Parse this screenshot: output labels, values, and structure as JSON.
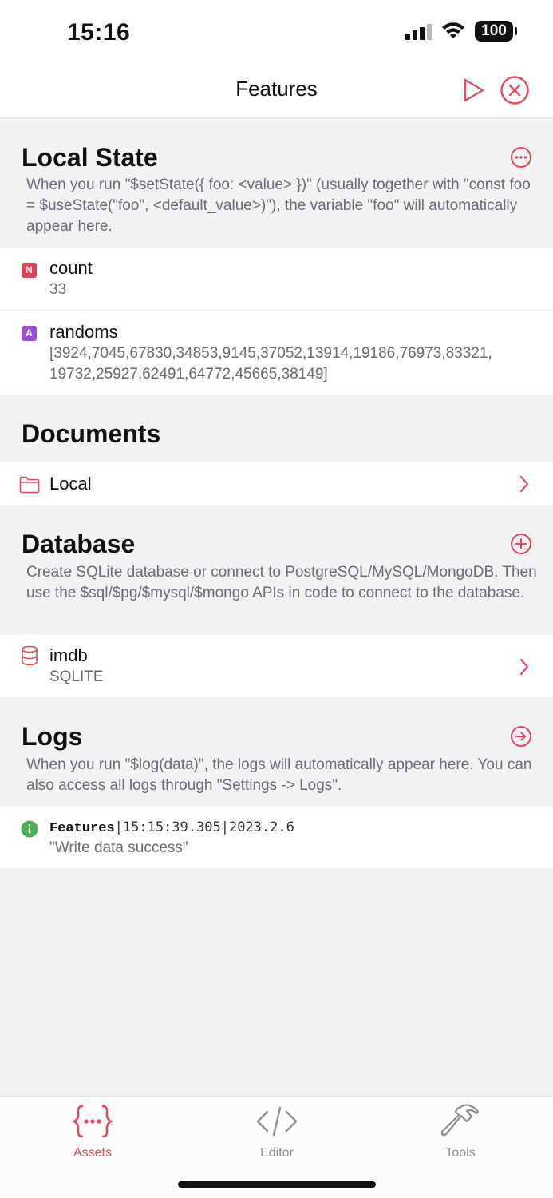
{
  "status_bar": {
    "time": "15:16",
    "battery": "100"
  },
  "nav": {
    "title": "Features",
    "run_icon": "play-icon",
    "close_icon": "close-circle-icon"
  },
  "local_state": {
    "title": "Local State",
    "description": "When you run \"$setState({ foo: <value> })\" (usually together with \"const foo = $useState(\"foo\", <default_value>)\"), the variable \"foo\" will automatically appear here.",
    "items": [
      {
        "badge": "N",
        "badge_color": "#e5405a",
        "name": "count",
        "value": "33"
      },
      {
        "badge": "A",
        "badge_color": "#9a4fd6",
        "name": "randoms",
        "value": "[3924,7045,67830,34853,9145,37052,13914,19186,76973,83321,\n19732,25927,62491,64772,45665,38149]"
      }
    ]
  },
  "documents": {
    "title": "Documents",
    "items": [
      {
        "icon": "folder-icon",
        "label": "Local"
      }
    ]
  },
  "database": {
    "title": "Database",
    "description": "Create SQLite database or connect to PostgreSQL/MySQL/MongoDB. Then use the $sql/$pg/$mysql/$mongo APIs in code to connect to the database.",
    "items": [
      {
        "icon": "database-icon",
        "label": "imdb",
        "type": "SQLITE"
      }
    ]
  },
  "logs": {
    "title": "Logs",
    "description": "When you run \"$log(data)\", the logs will automatically appear here. You can also access all logs through \"Settings -> Logs\".",
    "entries": [
      {
        "source": "Features",
        "sep": "|",
        "time": "15:15:39.305",
        "date": "2023.2.6",
        "message": "\"Write data success\""
      }
    ]
  },
  "tabs": [
    {
      "label": "Assets",
      "icon": "braces-dots-icon",
      "active": true
    },
    {
      "label": "Editor",
      "icon": "code-icon",
      "active": false
    },
    {
      "label": "Tools",
      "icon": "hammer-icon",
      "active": false
    }
  ],
  "colors": {
    "accent": "#e44a5c",
    "log_info": "#4caf50"
  }
}
